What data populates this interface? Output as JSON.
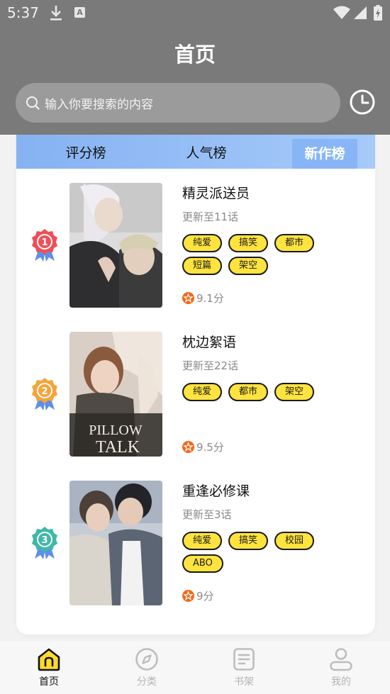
{
  "status_bar": {
    "time": "5:37",
    "a_label": "A"
  },
  "header": {
    "title": "首页"
  },
  "search": {
    "placeholder": "输入你要搜索的内容"
  },
  "tabs": [
    {
      "label": "评分榜",
      "active": false
    },
    {
      "label": "人气榜",
      "active": false
    },
    {
      "label": "新作榜",
      "active": true
    }
  ],
  "items": [
    {
      "rank": "1",
      "title": "精灵派送员",
      "update": "更新至11话",
      "tags": [
        "纯爱",
        "搞笑",
        "都市",
        "短篇",
        "架空"
      ],
      "rating": "9.1分",
      "badge_color": "#ef4f57"
    },
    {
      "rank": "2",
      "title": "枕边絮语",
      "update": "更新至22话",
      "tags": [
        "纯爱",
        "都市",
        "架空"
      ],
      "rating": "9.5分",
      "badge_color": "#f5a43a"
    },
    {
      "rank": "3",
      "title": "重逢必修课",
      "update": "更新至3话",
      "tags": [
        "纯爱",
        "搞笑",
        "校园",
        "ABO"
      ],
      "rating": "9分",
      "badge_color": "#3fb8a8"
    }
  ],
  "covers": {
    "cover2_text_line1": "PILLOW",
    "cover2_text_line2": "TALK"
  },
  "bottom_nav": [
    {
      "label": "首页",
      "icon": "home-icon",
      "active": true
    },
    {
      "label": "分类",
      "icon": "compass-icon",
      "active": false
    },
    {
      "label": "书架",
      "icon": "bookshelf-icon",
      "active": false
    },
    {
      "label": "我的",
      "icon": "profile-icon",
      "active": false
    }
  ],
  "colors": {
    "accent_yellow": "#ffe33f",
    "tab_blue": "#88b5f5",
    "rating_orange": "#f06a1c"
  }
}
